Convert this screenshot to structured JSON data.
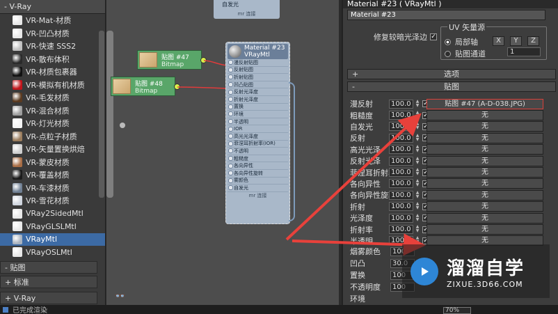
{
  "left_panel": {
    "header": "- V-Ray",
    "materials": [
      {
        "label": "VR-Mat-材质",
        "color": "#e8e8e8"
      },
      {
        "label": "VR-凹凸材质",
        "color": "#e8e8e8"
      },
      {
        "label": "VR-快速 SSS2",
        "color": "#bfbfbf"
      },
      {
        "label": "VR-散布体积",
        "color": "#2a2a2a"
      },
      {
        "label": "VR-材质包裹器",
        "color": "#111111"
      },
      {
        "label": "VR-模拟有机材质",
        "color": "#c0141a"
      },
      {
        "label": "VR-毛发材质",
        "color": "#5a3a20"
      },
      {
        "label": "VR-混合材质",
        "color": "#9e9e9e"
      },
      {
        "label": "VR-灯光材质",
        "color": "#f4f4f4"
      },
      {
        "label": "VR-点粒子材质",
        "color": "#9a7c5c"
      },
      {
        "label": "VR-矢量置换烘焙",
        "color": "#cfcfcf"
      },
      {
        "label": "VR-蒙皮材质",
        "color": "#a86d45"
      },
      {
        "label": "VR-覆盖材质",
        "color": "#1a1a1a"
      },
      {
        "label": "VR-车漆材质",
        "color": "#6f7f93"
      },
      {
        "label": "VR-雪花材质",
        "color": "#d0d6df"
      },
      {
        "label": "VRay2SidedMtl",
        "color": "#e8e8e8"
      },
      {
        "label": "VRayGLSLMtl",
        "color": "#e8e8e8"
      },
      {
        "label": "VRayMtl",
        "color": "#a8b2bf"
      },
      {
        "label": "VRayOSLMtl",
        "color": "#e8e8e8"
      }
    ],
    "selected_index": 17,
    "sections": [
      "- 贴图",
      "+ 标准",
      "+ V-Ray"
    ]
  },
  "status": {
    "text": "已完成渲染"
  },
  "canvas": {
    "top_node_label": "自发光",
    "top_node_footer": "mr 连接",
    "bitmap_nodes": [
      {
        "title": "贴图 #47",
        "type": "Bitmap"
      },
      {
        "title": "贴图 #48",
        "type": "Bitmap"
      }
    ],
    "vray_node": {
      "title": "Material #23",
      "type": "VRayMtl",
      "slots": [
        "漫反射贴图",
        "反射贴图",
        "折射贴图",
        "凹凸贴图",
        "反射光泽度",
        "折射光泽度",
        "置换",
        "环境",
        "半透明",
        "IOR",
        "高光光泽度",
        "菲涅耳折射率(IOR)",
        "不透明",
        "粗糙度",
        "各向异性",
        "各向异性旋转",
        "雾颜色",
        "自发光"
      ],
      "footer": "mr 连接"
    }
  },
  "editor": {
    "title": "Material #23  ( VRayMtl )",
    "name": "Material #23",
    "fix_dark_edges": "修复较暗光泽边",
    "uv_group": "UV 矢量源",
    "radio_local": "局部轴",
    "radio_channel": "贴图通道",
    "channel_value": "1",
    "axes": [
      "X",
      "Y",
      "Z"
    ],
    "rollout_options": "选项",
    "rollout_maps": "贴图",
    "map_rows": [
      {
        "label": "漫反射",
        "value": "100.0",
        "map": "贴图 #47 (A-D-038.JPG)",
        "highlight": true
      },
      {
        "label": "粗糙度",
        "value": "100.0",
        "map": "无"
      },
      {
        "label": "自发光",
        "value": "100.0",
        "map": "无"
      },
      {
        "label": "反射",
        "value": "100.0",
        "map": "无"
      },
      {
        "label": "高光光泽",
        "value": "100.0",
        "map": "无"
      },
      {
        "label": "反射光泽",
        "value": "100.0",
        "map": "无"
      },
      {
        "label": "菲涅耳折射率",
        "value": "100.0",
        "map": "无"
      },
      {
        "label": "各向异性",
        "value": "100.0",
        "map": "无"
      },
      {
        "label": "各向异性旋转",
        "value": "100.0",
        "map": "无"
      },
      {
        "label": "折射",
        "value": "100.0",
        "map": "无"
      },
      {
        "label": "光泽度",
        "value": "100.0",
        "map": "无"
      },
      {
        "label": "折射率",
        "value": "100.0",
        "map": "无"
      },
      {
        "label": "半透明",
        "value": "100.0",
        "map": "无"
      }
    ],
    "fog_color": {
      "label": "烟雾颜色",
      "value": "100"
    },
    "bump": {
      "label": "凹凸",
      "value": "30.0"
    },
    "displace": {
      "label": "置换",
      "value": "100"
    },
    "opacity": {
      "label": "不透明度",
      "value": "100"
    },
    "environment": {
      "label": "环境"
    },
    "zoom": "70%"
  },
  "watermark": {
    "cn": "溜溜自学",
    "url": "ZIXUE.3D66.COM"
  },
  "colors": {
    "node_green": "#59a669",
    "wire_red": "#e03b3b",
    "arrow_red": "#e8413b",
    "accent_blue": "#3c6aa4"
  }
}
